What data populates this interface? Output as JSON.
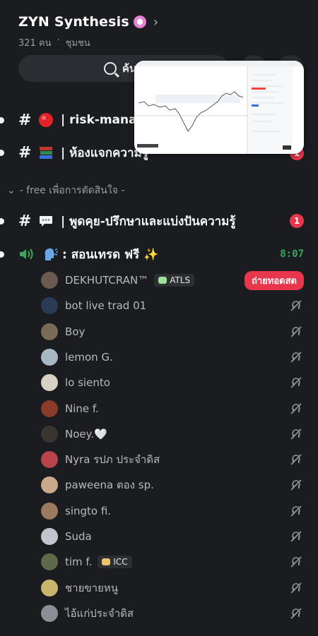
{
  "server": {
    "name": "ZYN Synthesis",
    "member_count": "321 คน",
    "separator": "·",
    "type": "ชุมชน"
  },
  "search": {
    "label": "ค้นห"
  },
  "channels": [
    {
      "name": "| risk-mana",
      "emoji": "red-circle",
      "unread": true
    },
    {
      "name": "| ห้องแจกความรู้",
      "emoji": "books",
      "unread": true,
      "badge": "1"
    }
  ],
  "category": {
    "label": "- free เพื่อการตัดสินใจ  -"
  },
  "channel_chat": {
    "name": "| พูดคุย-ปรึกษาและแบ่งปันความรู้",
    "emoji": "speech-balloon",
    "badge": "1"
  },
  "voice_channel": {
    "name": ": สอนเทรด ฟรี ✨",
    "time": "8:07"
  },
  "members": [
    {
      "name": "DEKHUTCRAN™",
      "tag": "ATLS",
      "tag_color": "#9be39b",
      "live": "ถ่ายทอดสด",
      "avatar_color": "#6b5a52"
    },
    {
      "name": "bot live trad 01",
      "avatar_color": "#2b3b55"
    },
    {
      "name": "Boy",
      "avatar_color": "#7a6a58"
    },
    {
      "name": "lemon G.",
      "avatar_color": "#a7b8c4"
    },
    {
      "name": "lo siento",
      "avatar_color": "#d9d2c4"
    },
    {
      "name": "Nine f.",
      "avatar_color": "#8a3b2a"
    },
    {
      "name": "Noey.🤍",
      "avatar_color": "#3a3430"
    },
    {
      "name": "Nyra รปภ ประจำดิส",
      "avatar_color": "#b8434a"
    },
    {
      "name": "paweena ตอง sp.",
      "avatar_color": "#c9a98a"
    },
    {
      "name": "singto fi.",
      "avatar_color": "#9c7a60"
    },
    {
      "name": "Suda",
      "avatar_color": "#c2c6cc"
    },
    {
      "name": "tim f.",
      "tag": "ICC",
      "tag_color": "#e9c46a",
      "avatar_color": "#5d6a4a"
    },
    {
      "name": "ชายขายหนู",
      "avatar_color": "#c8b46a"
    },
    {
      "name": "ไอ้แก่ประจำดิส",
      "avatar_color": "#8c8f96"
    }
  ],
  "colors": {
    "background": "#1b1c20",
    "badge_red": "#e8374d",
    "voice_green": "#3ba55d"
  }
}
